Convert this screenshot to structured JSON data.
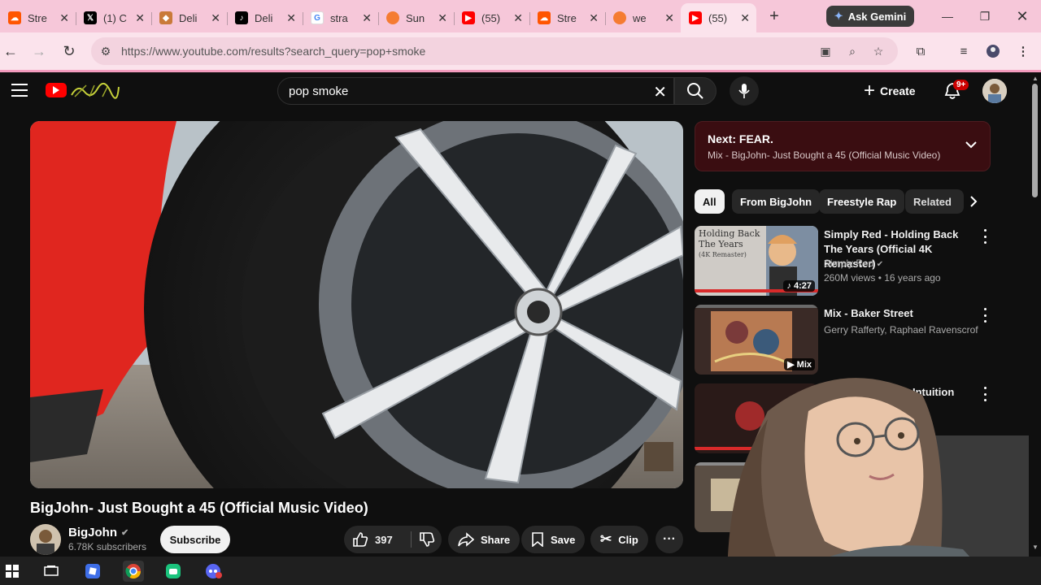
{
  "browser": {
    "tabs": [
      {
        "title": "Stre",
        "icon": "soundcloud-icon",
        "color": "#ff5500"
      },
      {
        "title": "(1) C",
        "icon": "x-icon",
        "color": "#000000"
      },
      {
        "title": "Deli",
        "icon": "deli-icon",
        "color": "#c97a3a"
      },
      {
        "title": "Deli",
        "icon": "tiktok-icon",
        "color": "#000000"
      },
      {
        "title": "stra",
        "icon": "google-icon",
        "color": "#4285f4"
      },
      {
        "title": "Sun",
        "icon": "orange-circle-icon",
        "color": "#f57c32"
      },
      {
        "title": "(55)",
        "icon": "youtube-icon",
        "color": "#ff0000"
      },
      {
        "title": "Stre",
        "icon": "soundcloud-icon",
        "color": "#ff5500"
      },
      {
        "title": "we",
        "icon": "orange-circle-icon",
        "color": "#f57c32"
      },
      {
        "title": "(55)",
        "icon": "youtube-icon",
        "color": "#ff0000",
        "active": true
      }
    ],
    "gemini_label": "Ask Gemini",
    "url": "https://www.youtube.com/results?search_query=pop+smoke"
  },
  "youtube": {
    "search_query": "pop smoke",
    "create_label": "Create",
    "notif_badge": "9+",
    "video": {
      "title": "BigJohn- Just Bought a 45 (Official Music Video)",
      "channel": "BigJohn",
      "subscribers": "6.78K subscribers",
      "subscribe_label": "Subscribe",
      "likes": "397",
      "share_label": "Share",
      "save_label": "Save",
      "clip_label": "Clip"
    },
    "next": {
      "label": "Next: FEAR.",
      "subtitle": "Mix - BigJohn- Just Bought a 45 (Official Music Video)"
    },
    "chips": [
      "All",
      "From BigJohn",
      "Freestyle Rap",
      "Related"
    ],
    "recommendations": [
      {
        "title": "Simply Red - Holding Back The Years (Official 4K Remaster)",
        "channel": "Simply Red",
        "meta": "260M views • 16 years ago",
        "badge": "4:27"
      },
      {
        "title": "Mix - Baker Street",
        "channel": "Gerry Rafferty, Raphael Ravenscroft, Al S...",
        "meta": "",
        "badge": "Mix"
      },
      {
        "title": "Intuition",
        "channel": "",
        "meta": "",
        "badge": ""
      },
      {
        "title": "",
        "channel": "",
        "meta": "",
        "badge": ""
      }
    ],
    "thumb_text": {
      "simply_red_line1": "Holding Back",
      "simply_red_line2": "The Years",
      "simply_red_line3": "(4K Remaster)"
    }
  },
  "colors": {
    "tabstrip": "#f6c7d9",
    "toolbar": "#fbe3ec",
    "yt_bg": "#0f0f0f",
    "next_box": "#3a0d11"
  }
}
